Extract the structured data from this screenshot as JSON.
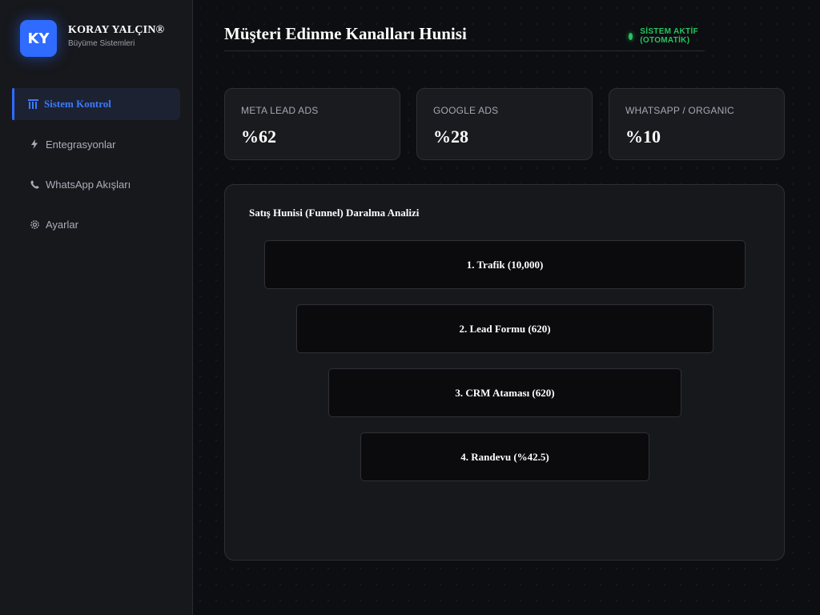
{
  "brand": {
    "logo_text": "KY",
    "name": "KORAY YALÇIN®",
    "subtitle": "Büyüme Sistemleri"
  },
  "sidebar": {
    "items": [
      {
        "icon": "bar-chart-icon",
        "glyph": "📊",
        "label": "Sistem Kontrol",
        "active": true
      },
      {
        "icon": "lightning-icon",
        "glyph": "⚡",
        "label": "Entegrasyonlar",
        "active": false
      },
      {
        "icon": "phone-icon",
        "glyph": "📞",
        "label": "WhatsApp Akışları",
        "active": false
      },
      {
        "icon": "gear-icon",
        "glyph": "⚙",
        "label": "Ayarlar",
        "active": false
      }
    ]
  },
  "header": {
    "title": "Müşteri Edinme Kanalları Hunisi",
    "status_text": "SİSTEM AKTİF (OTOMATİK)"
  },
  "stats": [
    {
      "label": "META LEAD ADS",
      "value": "%62"
    },
    {
      "label": "GOOGLE ADS",
      "value": "%28"
    },
    {
      "label": "WHATSAPP / ORGANIC",
      "value": "%10"
    }
  ],
  "funnel": {
    "title": "Satış Hunisi (Funnel) Daralma Analizi",
    "stages": [
      {
        "label": "1. Trafik (10,000)"
      },
      {
        "label": "2. Lead Formu (620)"
      },
      {
        "label": "3. CRM Ataması (620)"
      },
      {
        "label": "4. Randevu (%42.5)"
      }
    ]
  },
  "colors": {
    "accent": "#2f6bff",
    "status": "#22c55e",
    "background": "#0d0e11",
    "panel": "#17181c"
  }
}
